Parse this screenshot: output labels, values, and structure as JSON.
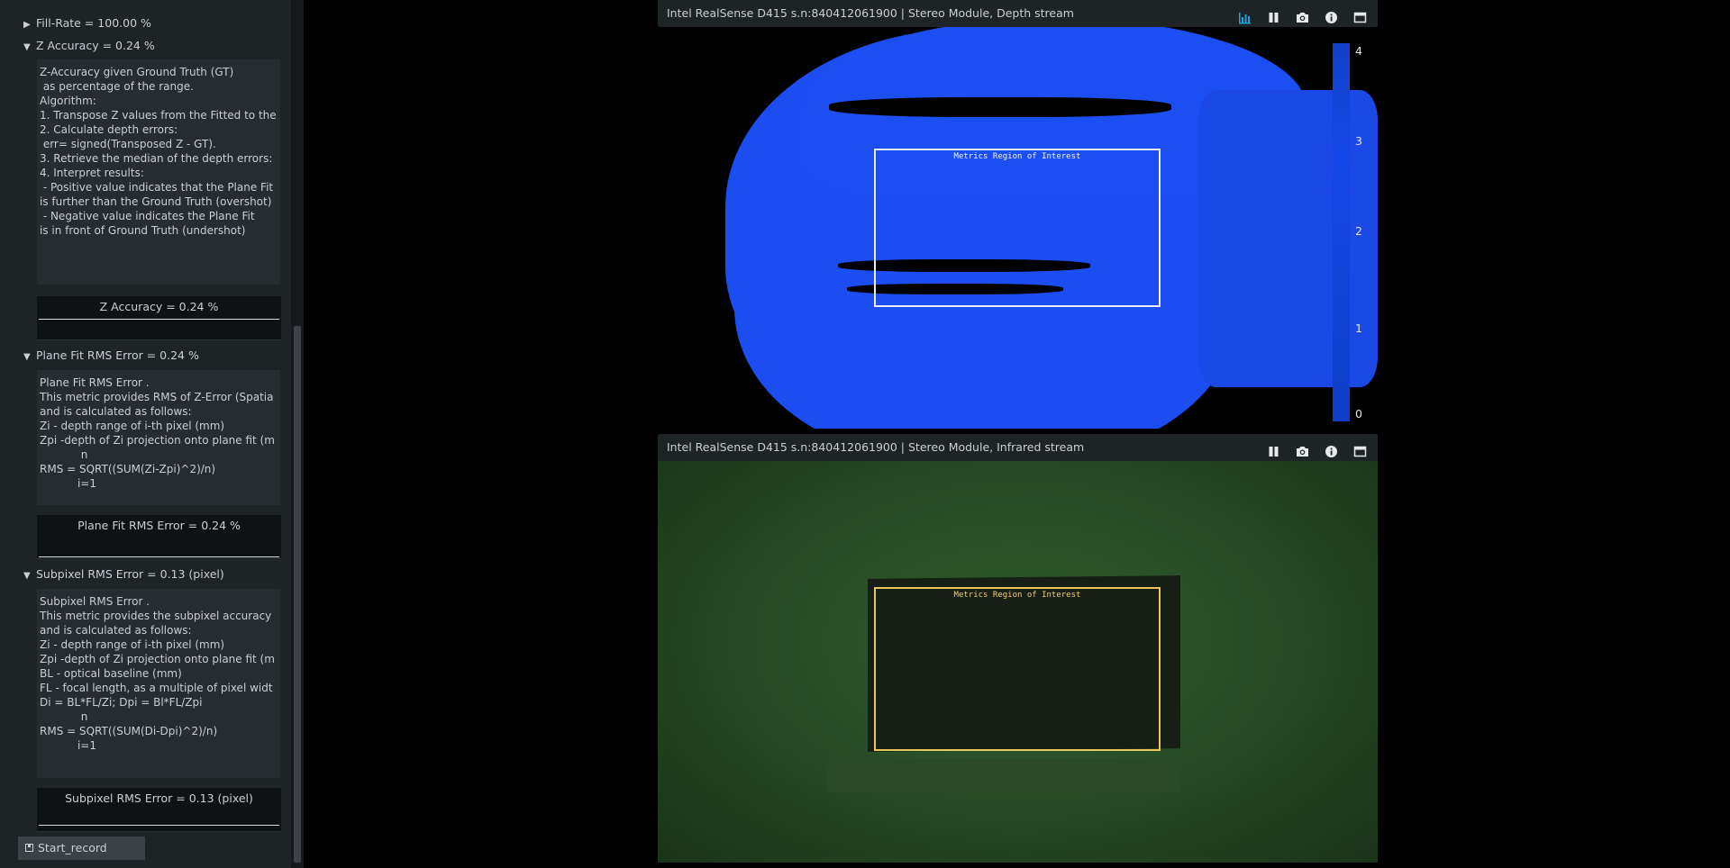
{
  "metrics_panel": {
    "fill_rate_header": "Fill-Rate = 100.00 %",
    "z_accuracy": {
      "header": "Z Accuracy = 0.24 %",
      "description": [
        "Z-Accuracy given Ground Truth (GT)",
        " as percentage of the range.",
        "Algorithm:",
        "1. Transpose Z values from the Fitted to the",
        "2. Calculate depth errors:",
        " err= signed(Transposed Z - GT).",
        "3. Retrieve the median of the depth errors:",
        "4. Interpret results:",
        " - Positive value indicates that the Plane Fit",
        "is further than the Ground Truth (overshot)",
        " - Negative value indicates the Plane Fit",
        "is in front of Ground Truth (undershot)"
      ],
      "plot_title": "Z Accuracy = 0.24 %"
    },
    "plane_fit": {
      "header": "Plane Fit RMS Error = 0.24 %",
      "description": [
        "Plane Fit RMS Error .",
        "This metric provides RMS of Z-Error (Spatia",
        "and is calculated as follows:",
        "Zi - depth range of i-th pixel (mm)",
        "Zpi -depth of Zi projection onto plane fit (m",
        "            n",
        "RMS = SQRT((SUM(Zi-Zpi)^2)/n)",
        "           i=1"
      ],
      "plot_title": "Plane Fit RMS Error = 0.24 %"
    },
    "subpixel": {
      "header": "Subpixel RMS Error = 0.13 (pixel)",
      "description": [
        "Subpixel RMS Error .",
        "This metric provides the subpixel accuracy",
        "and is calculated as follows:",
        "Zi - depth range of i-th pixel (mm)",
        "Zpi -depth of Zi projection onto plane fit (m",
        "BL - optical baseline (mm)",
        "FL - focal length, as a multiple of pixel widt",
        "Di = BL*FL/Zi; Dpi = Bl*FL/Zpi",
        "            n",
        "RMS = SQRT((SUM(Di-Dpi)^2)/n)",
        "           i=1"
      ],
      "plot_title": "Subpixel RMS Error = 0.13 (pixel)"
    },
    "record_button": "Start_record"
  },
  "depth_stream": {
    "title": "Intel RealSense D415 s.n:840412061900 | Stereo Module, Depth stream",
    "roi_label": "Metrics Region of Interest",
    "colorbar_ticks": [
      "4",
      "3",
      "2",
      "1",
      "0"
    ],
    "icons": [
      "metrics-icon",
      "pause-icon",
      "camera-icon",
      "info-icon",
      "maximize-icon"
    ]
  },
  "infrared_stream": {
    "title": "Intel RealSense D415 s.n:840412061900 | Stereo Module, Infrared stream",
    "roi_label": "Metrics Region of Interest",
    "icons": [
      "pause-icon",
      "camera-icon",
      "info-icon",
      "maximize-icon"
    ]
  },
  "colors": {
    "panel_bg": "#1e2326",
    "depth_blue": "#1b4df0",
    "accent_cyan": "#1fa3e0",
    "roi_ir": "#e8c55a"
  }
}
